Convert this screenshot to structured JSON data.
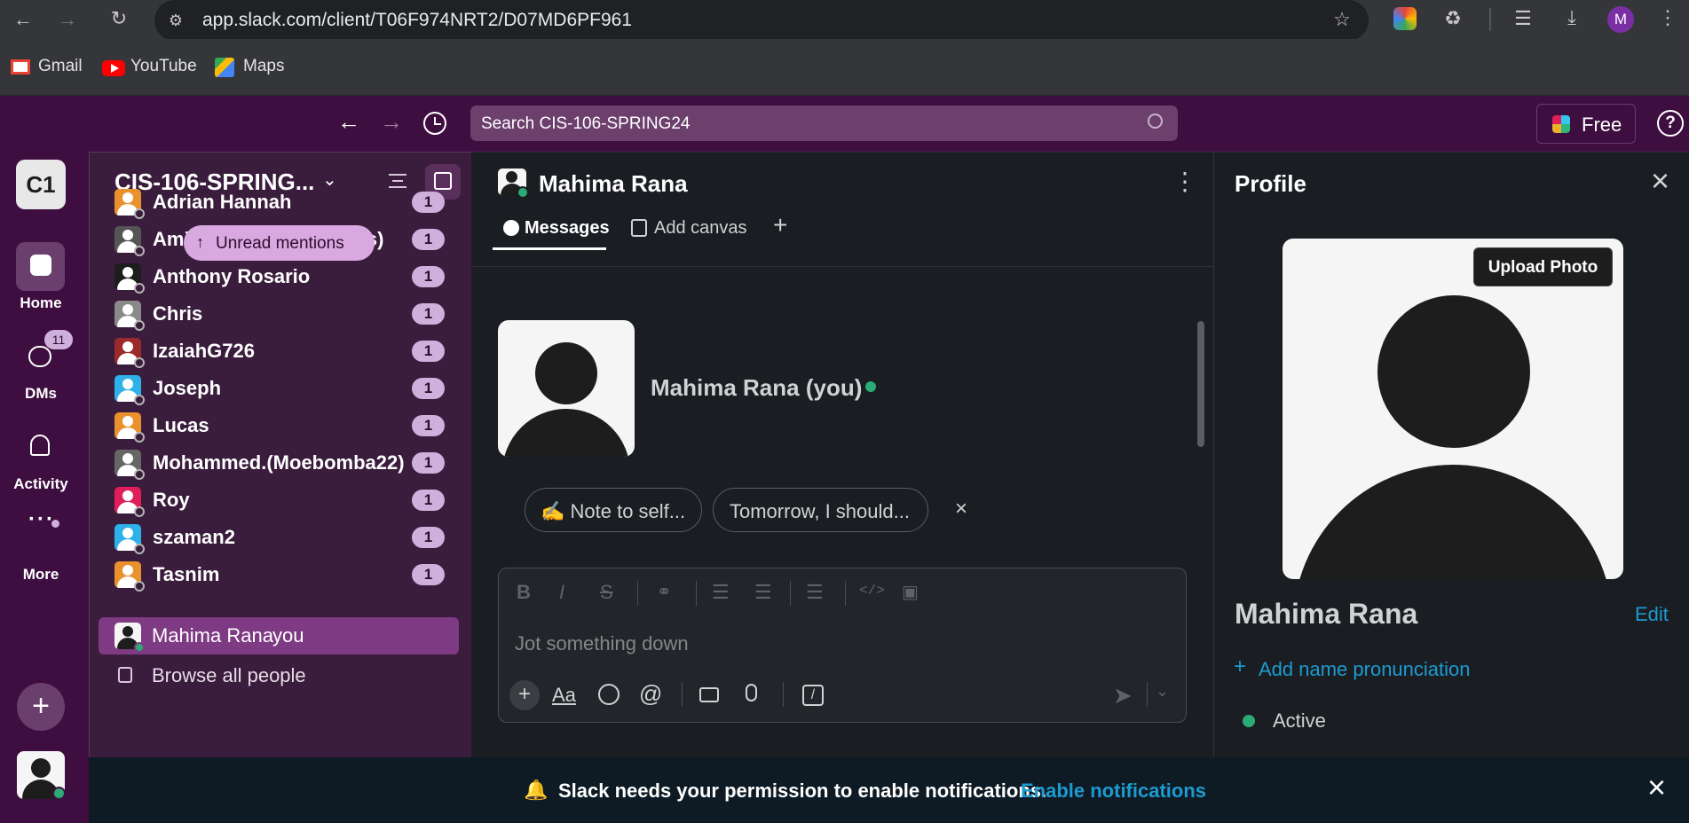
{
  "browser": {
    "url": "app.slack.com/client/T06F974NRT2/D07MD6PF961",
    "profile_initial": "M",
    "bookmarks": [
      {
        "label": "Gmail"
      },
      {
        "label": "YouTube"
      },
      {
        "label": "Maps"
      }
    ]
  },
  "slack_top": {
    "search_placeholder": "Search CIS-106-SPRING24",
    "free_label": "Free"
  },
  "rail": {
    "workspace_initials": "C1",
    "home_label": "Home",
    "dms_label": "DMs",
    "dms_badge": "11",
    "activity_label": "Activity",
    "more_label": "More"
  },
  "sidebar": {
    "workspace_name": "CIS-106-SPRING...",
    "unread_mentions_label": "Unread mentions",
    "dms": [
      {
        "name": "Adrian Hannah",
        "badge": "1",
        "color": "#e8912d"
      },
      {
        "name": "Amilcar (amilcarangeles)",
        "badge": "1",
        "color": "#555"
      },
      {
        "name": "Anthony Rosario",
        "badge": "1",
        "color": "#1d1d1d"
      },
      {
        "name": "Chris",
        "badge": "1",
        "color": "#8a8a8a"
      },
      {
        "name": "IzaiahG726",
        "badge": "1",
        "color": "#9b2a2a"
      },
      {
        "name": "Joseph",
        "badge": "1",
        "color": "#2eb0e8"
      },
      {
        "name": "Lucas",
        "badge": "1",
        "color": "#e8912d"
      },
      {
        "name": "Mohammed.(Moebomba22)",
        "badge": "1",
        "color": "#666"
      },
      {
        "name": "Roy",
        "badge": "1",
        "color": "#e01e5a"
      },
      {
        "name": "szaman2",
        "badge": "1",
        "color": "#2eb0e8"
      },
      {
        "name": "Tasnim",
        "badge": "1",
        "color": "#e8912d"
      }
    ],
    "self_name": "Mahima Rana",
    "self_suffix": "you",
    "browse_label": "Browse all people"
  },
  "main": {
    "title": "Mahima Rana",
    "tabs": [
      {
        "label": "Messages"
      },
      {
        "label": "Add canvas"
      }
    ],
    "intro_name": "Mahima Rana (you)",
    "suggestions": [
      {
        "label": "✍️ Note to self..."
      },
      {
        "label": "Tomorrow, I should..."
      }
    ],
    "composer_placeholder": "Jot something down",
    "aa_label": "Aa"
  },
  "profile": {
    "header": "Profile",
    "upload_label": "Upload Photo",
    "name": "Mahima Rana",
    "edit_label": "Edit",
    "pronunciation_label": "Add name pronunciation",
    "status": "Active"
  },
  "banner": {
    "message": "Slack needs your permission to enable notifications.",
    "link": "Enable notifications"
  },
  "colors": {
    "aubergine": "#3f0e40",
    "badge": "#cfb0dd",
    "link": "#1d9bd1",
    "online": "#2bac76"
  }
}
